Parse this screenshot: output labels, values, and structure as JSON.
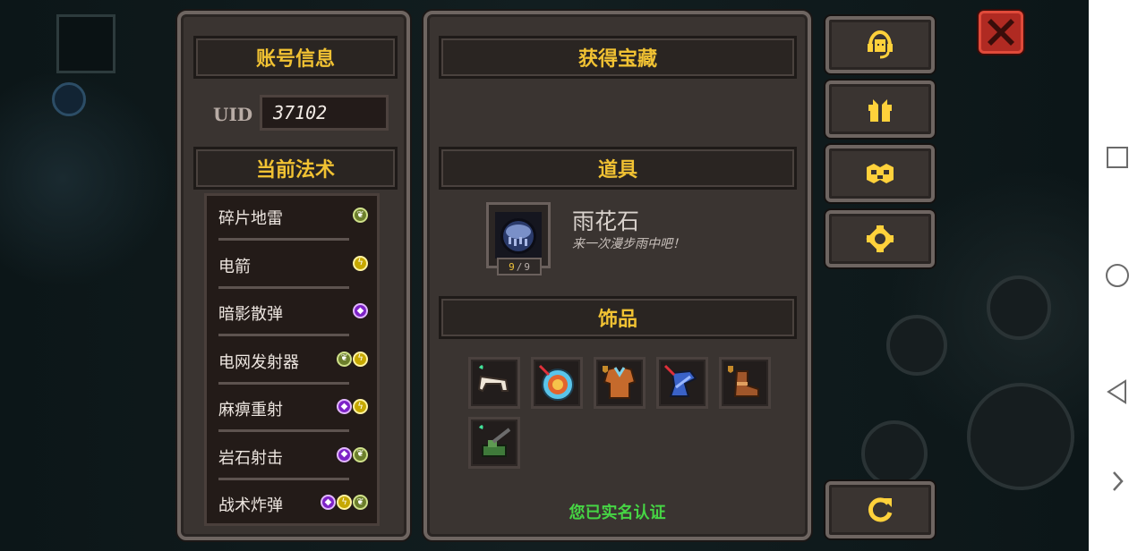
{
  "account": {
    "header": "账号信息",
    "uid_label": "UID",
    "uid_value": "37102"
  },
  "spells": {
    "header": "当前法术",
    "items": [
      {
        "name": "碎片地雷",
        "elements": [
          "earth"
        ]
      },
      {
        "name": "电箭",
        "elements": [
          "volt"
        ]
      },
      {
        "name": "暗影散弹",
        "elements": [
          "shadow"
        ]
      },
      {
        "name": "电网发射器",
        "elements": [
          "earth",
          "volt"
        ]
      },
      {
        "name": "麻痹重射",
        "elements": [
          "shadow",
          "volt"
        ]
      },
      {
        "name": "岩石射击",
        "elements": [
          "shadow",
          "earth"
        ]
      },
      {
        "name": "战术炸弹",
        "elements": [
          "shadow",
          "volt",
          "earth"
        ]
      }
    ]
  },
  "treasure": {
    "header": "获得宝藏",
    "items_header": "道具",
    "item": {
      "name": "雨花石",
      "description": "来一次漫步雨中吧！",
      "count_current": "9",
      "count_separator": "/",
      "count_max": "9",
      "icon": "rain-stone-icon"
    },
    "accessories_header": "饰品",
    "accessories": [
      {
        "icon": "bone-wing-icon",
        "badge": "heart"
      },
      {
        "icon": "target-shield-icon",
        "badge": "red-slash"
      },
      {
        "icon": "leather-vest-icon",
        "badge": "shield"
      },
      {
        "icon": "blue-boot-icon",
        "badge": "red-slash"
      },
      {
        "icon": "brown-boot-icon",
        "badge": "shield"
      },
      {
        "icon": "green-turret-icon",
        "badge": "heart"
      }
    ],
    "verified_text": "您已实名认证"
  },
  "side_buttons": [
    {
      "icon": "customer-service-icon"
    },
    {
      "icon": "gift-icon"
    },
    {
      "icon": "mask-icon"
    },
    {
      "icon": "settings-gear-icon"
    },
    {
      "icon": "restart-icon"
    }
  ],
  "colors": {
    "header_text": "#f1c233",
    "verified": "#46d544",
    "panel_bg": "#3a3431",
    "panel_border": "#6e6561",
    "close": "#b02a22"
  }
}
